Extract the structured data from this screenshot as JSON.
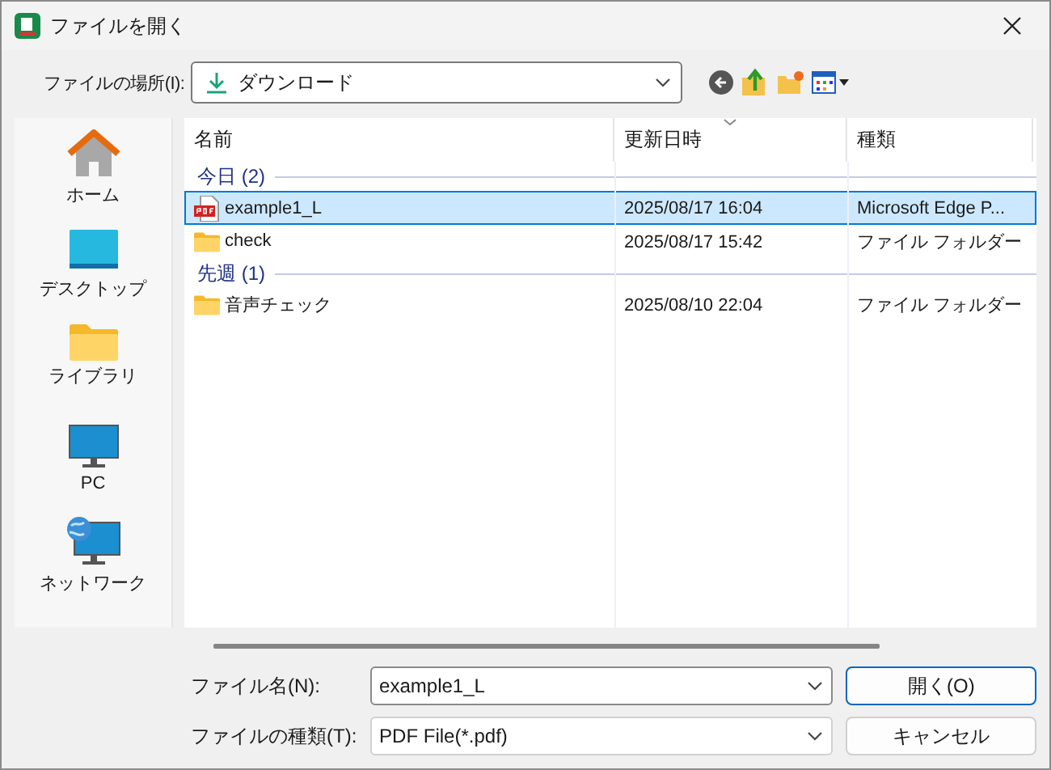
{
  "window": {
    "title": "ファイルを開く"
  },
  "location": {
    "label": "ファイルの場所(I):",
    "value": "ダウンロード"
  },
  "sidebar": {
    "items": [
      {
        "label": "ホーム",
        "kind": "home"
      },
      {
        "label": "デスクトップ",
        "kind": "desktop"
      },
      {
        "label": "ライブラリ",
        "kind": "library"
      },
      {
        "label": "PC",
        "kind": "pc"
      },
      {
        "label": "ネットワーク",
        "kind": "network"
      }
    ]
  },
  "table": {
    "columns": [
      "名前",
      "更新日時",
      "種類"
    ],
    "groups": [
      {
        "label": "今日 (2)",
        "rows": [
          {
            "name": "example1_L",
            "kind": "pdf",
            "date": "2025/08/17 16:04",
            "type": "Microsoft Edge P...",
            "selected": true
          },
          {
            "name": "check",
            "kind": "folder",
            "date": "2025/08/17 15:42",
            "type": "ファイル フォルダー",
            "selected": false
          }
        ]
      },
      {
        "label": "先週 (1)",
        "rows": [
          {
            "name": "音声チェック",
            "kind": "folder",
            "date": "2025/08/10 22:04",
            "type": "ファイル フォルダー",
            "selected": false
          }
        ]
      }
    ]
  },
  "file_name": {
    "label": "ファイル名(N):",
    "value": "example1_L"
  },
  "file_type": {
    "label": "ファイルの種類(T):",
    "value": "PDF File(*.pdf)"
  },
  "buttons": [
    {
      "label": "開く(O)",
      "default": true
    },
    {
      "label": "キャンセル",
      "default": false
    }
  ]
}
